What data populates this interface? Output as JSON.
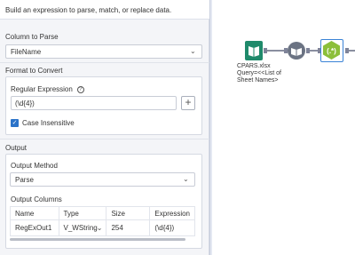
{
  "panel": {
    "description": "Build an expression to parse, match, or replace data.",
    "column_to_parse": {
      "label": "Column to Parse",
      "selected": "FileName"
    },
    "format_to_convert": {
      "label": "Format to Convert",
      "regex_label": "Regular Expression",
      "regex_value": "(\\d{4})",
      "case_insensitive_label": "Case Insensitive",
      "case_insensitive_checked": true
    },
    "output": {
      "label": "Output",
      "method_label": "Output Method",
      "method_selected": "Parse",
      "columns_label": "Output Columns",
      "table": {
        "headers": [
          "Name",
          "Type",
          "Size",
          "Expression"
        ],
        "rows": [
          {
            "name": "RegExOut1",
            "type": "V_WString",
            "size": "254",
            "expression": "(\\d{4})"
          }
        ]
      }
    }
  },
  "canvas": {
    "input_tool_label_line1": "CPARS.xlsx",
    "input_tool_label_line2": "Query=<<List of",
    "input_tool_label_line3": "Sheet Names>"
  },
  "colors": {
    "accent": "#2b73c9",
    "input_tool": "#1f8a6b",
    "browse_tool": "#6b7383",
    "regex_tool": "#8cbf3a"
  },
  "icons": [
    "chevron-down-icon",
    "info-icon",
    "plus-icon",
    "check-icon",
    "book-icon",
    "binoculars-icon",
    "regex-icon"
  ]
}
